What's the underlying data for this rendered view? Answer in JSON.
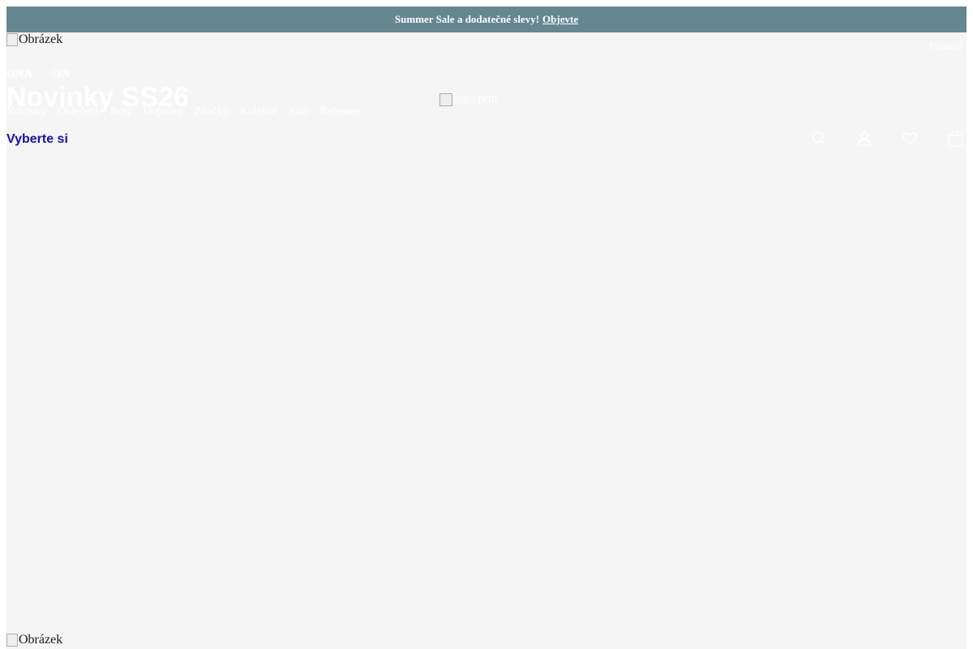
{
  "promo": {
    "text": "Summer Sale a dodatečné slevy!",
    "link_label": "Objevte",
    "close_glyph": ""
  },
  "hero_image_alt": "Obrázek",
  "logo_alt": "logo prm",
  "top_right_link": "Přihlásit",
  "gender_tabs": [
    "ONA",
    "ON"
  ],
  "hero_title": "Novinky SS26",
  "nav": [
    "Novinky",
    "Oblečení",
    "Boty",
    "Doplňky",
    "Značky",
    "Kolekce",
    "Sale",
    "Releases"
  ],
  "cta_label": "Vyberte si",
  "icons": [
    "search-icon",
    "user-icon",
    "heart-icon",
    "bag-icon"
  ],
  "colors": {
    "promo_bg": "#648790",
    "page_bg": "#f5f5f5",
    "cta": "#1a0dab"
  }
}
